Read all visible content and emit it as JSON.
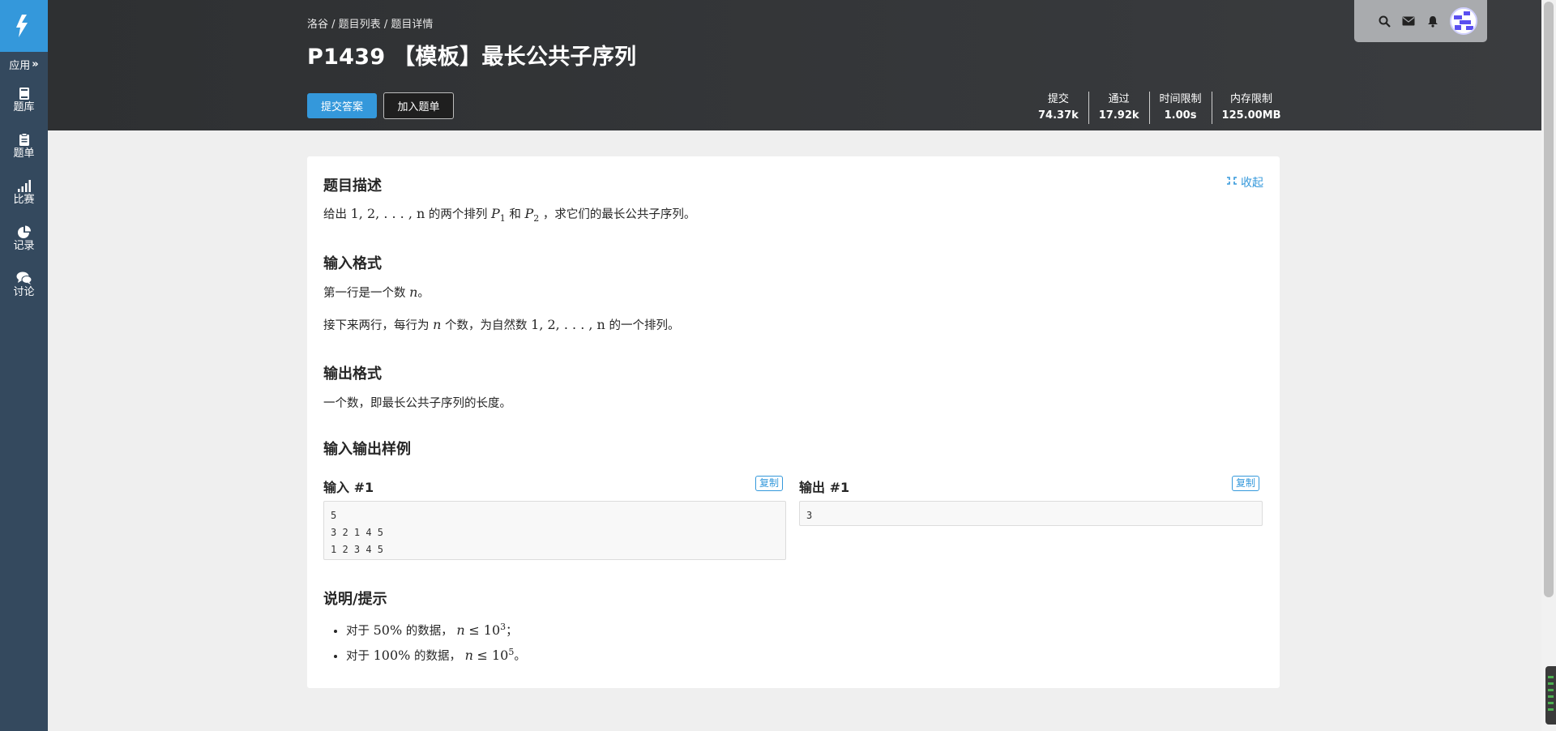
{
  "sidebar": {
    "apps_label": "应用",
    "items": [
      {
        "label": "题库",
        "icon": "book-icon"
      },
      {
        "label": "题单",
        "icon": "clipboard-icon"
      },
      {
        "label": "比赛",
        "icon": "bar-chart-icon"
      },
      {
        "label": "记录",
        "icon": "pie-chart-icon"
      },
      {
        "label": "讨论",
        "icon": "comments-icon"
      }
    ]
  },
  "header": {
    "breadcrumb": [
      "洛谷",
      "题目列表",
      "题目详情"
    ],
    "title": "P1439 【模板】最长公共子序列",
    "submit_label": "提交答案",
    "add_list_label": "加入题单",
    "stats": [
      {
        "label": "提交",
        "value": "74.37k"
      },
      {
        "label": "通过",
        "value": "17.92k"
      },
      {
        "label": "时间限制",
        "value": "1.00s"
      },
      {
        "label": "内存限制",
        "value": "125.00MB"
      }
    ]
  },
  "problem": {
    "collapse_label": "收起",
    "description_title": "题目描述",
    "description": {
      "t1": "给出",
      "seq": "1, 2, . . . , n",
      "t2": "的两个排列",
      "p1": "P",
      "sub1": "1",
      "t3": "和",
      "p2": "P",
      "sub2": "2",
      "t4": "，求它们的最长公共子序列。"
    },
    "input_title": "输入格式",
    "input_line1": {
      "t1": "第一行是一个数",
      "n": "n",
      "t2": "。"
    },
    "input_line2": {
      "t1": "接下来两行，每行为",
      "n": "n",
      "t2": "个数，为自然数",
      "seq": "1, 2, . . . , n",
      "t3": "的一个排列。"
    },
    "output_title": "输出格式",
    "output_text": "一个数，即最长公共子序列的长度。",
    "samples_title": "输入输出样例",
    "sample_input_label": "输入 #1",
    "sample_output_label": "输出 #1",
    "copy_label": "复制",
    "sample_input": "5\n3 2 1 4 5\n1 2 3 4 5",
    "sample_output": "3",
    "hint_title": "说明/提示",
    "hints": [
      {
        "t1": "对于",
        "pct": "50%",
        "t2": "的数据，",
        "n": "n",
        "le": "≤ 10",
        "exp": "3",
        "end": "；"
      },
      {
        "t1": "对于",
        "pct": "100%",
        "t2": "的数据，",
        "n": "n",
        "le": "≤ 10",
        "exp": "5",
        "end": "。"
      }
    ]
  },
  "colors": {
    "accent": "#3498db",
    "sidebar": "#34495e",
    "header": "#2e3032"
  }
}
